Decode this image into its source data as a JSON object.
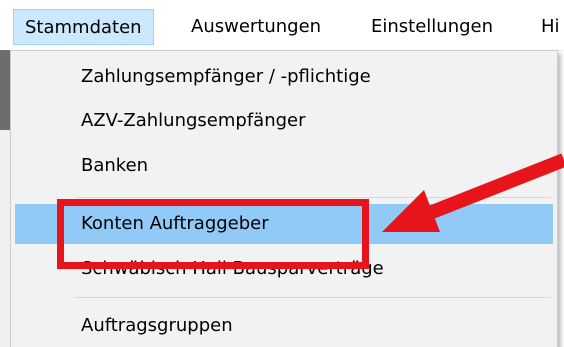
{
  "menubar": {
    "items": [
      {
        "label": "Stammdaten",
        "active": true
      },
      {
        "label": "Auswertungen"
      },
      {
        "label": "Einstellungen"
      },
      {
        "label": "Hi"
      }
    ]
  },
  "dropdown": {
    "items": [
      {
        "label": "Zahlungsempfänger / -pflichtige"
      },
      {
        "label": "AZV-Zahlungsempfänger"
      },
      {
        "label": "Banken"
      },
      {
        "label": "Konten Auftraggeber",
        "highlighted": true
      },
      {
        "label": "Schwäbisch Hall Bausparverträge"
      },
      {
        "label": "Auftragsgruppen"
      }
    ]
  },
  "annotation": {
    "color": "#e8141c",
    "arrow-icon": "red-arrow-icon"
  },
  "colors": {
    "highlight": "#91c9f7",
    "menu_active": "#cce8ff"
  }
}
